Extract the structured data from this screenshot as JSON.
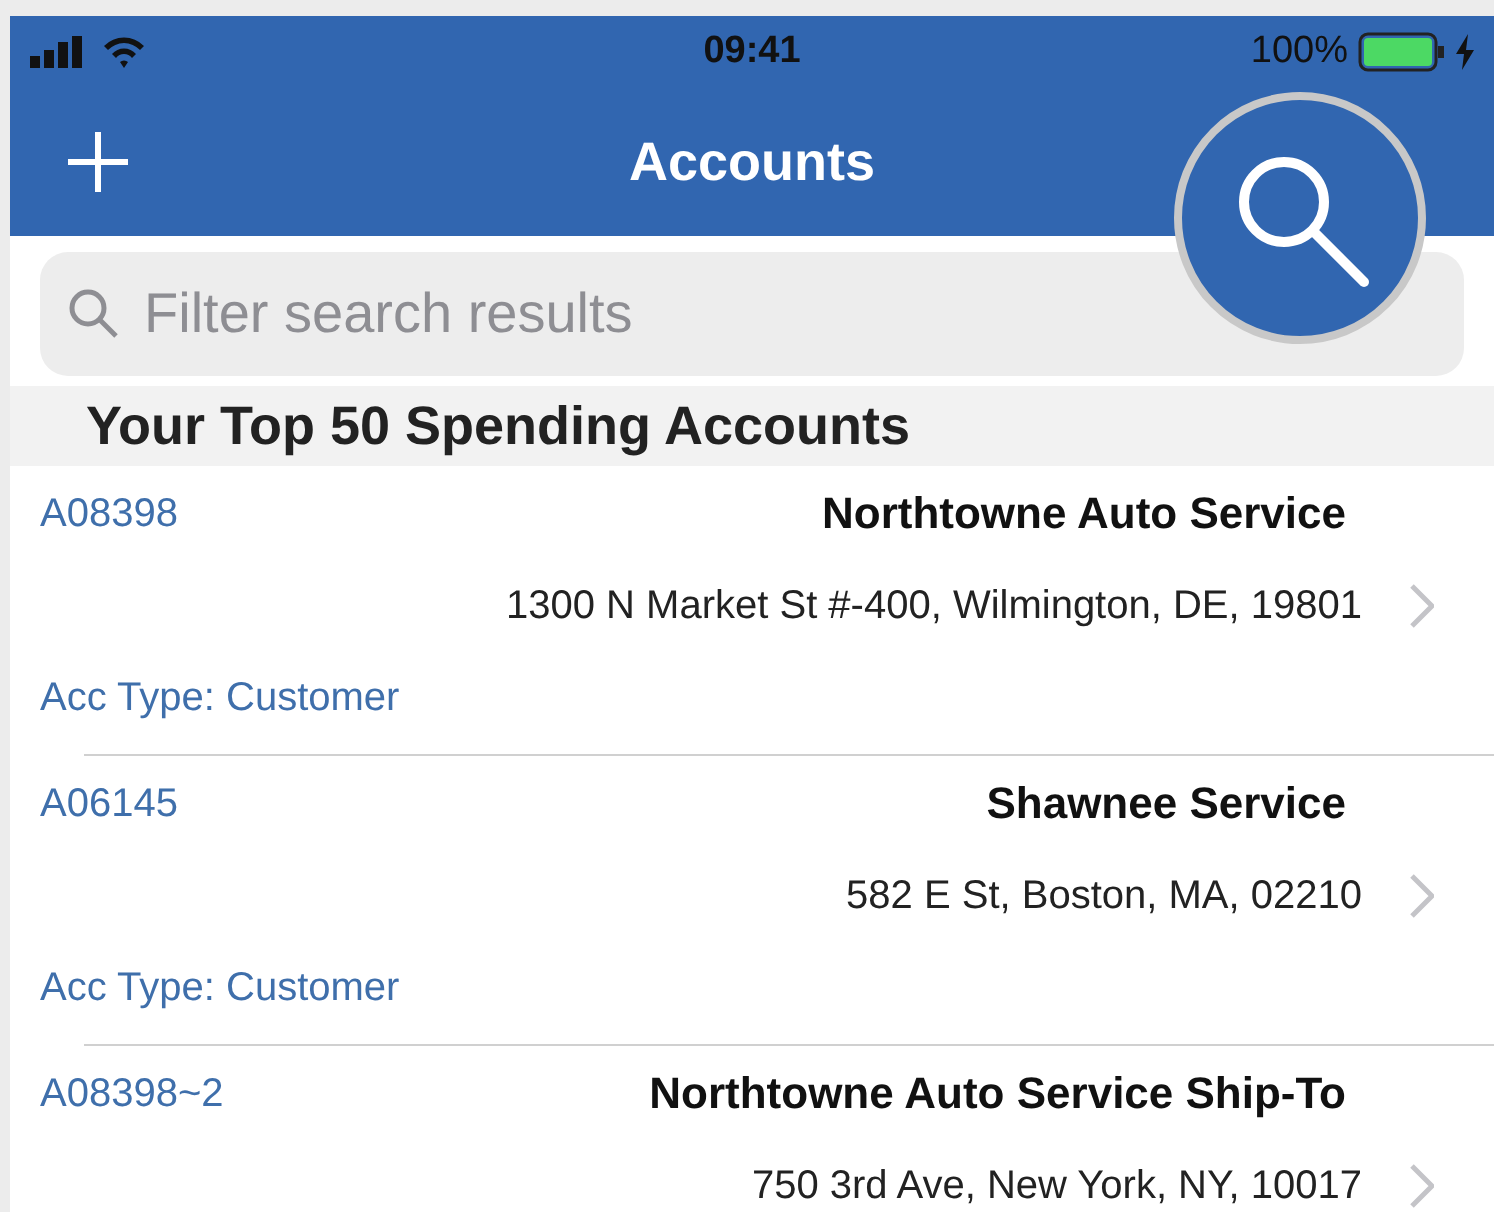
{
  "status_bar": {
    "time": "09:41",
    "battery": "100%"
  },
  "nav": {
    "title": "Accounts"
  },
  "search": {
    "placeholder": "Filter search results"
  },
  "section": {
    "title": "Your Top 50 Spending Accounts"
  },
  "accounts": [
    {
      "id": "A08398",
      "name": "Northtowne Auto Service",
      "address": "1300 N Market St #-400, Wilmington, DE, 19801",
      "type": "Acc Type: Customer"
    },
    {
      "id": "A06145",
      "name": "Shawnee Service",
      "address": "582 E St, Boston, MA, 02210",
      "type": "Acc Type: Customer"
    },
    {
      "id": "A08398~2",
      "name": "Northtowne Auto Service Ship-To",
      "address": "750 3rd Ave, New York, NY, 10017"
    }
  ]
}
